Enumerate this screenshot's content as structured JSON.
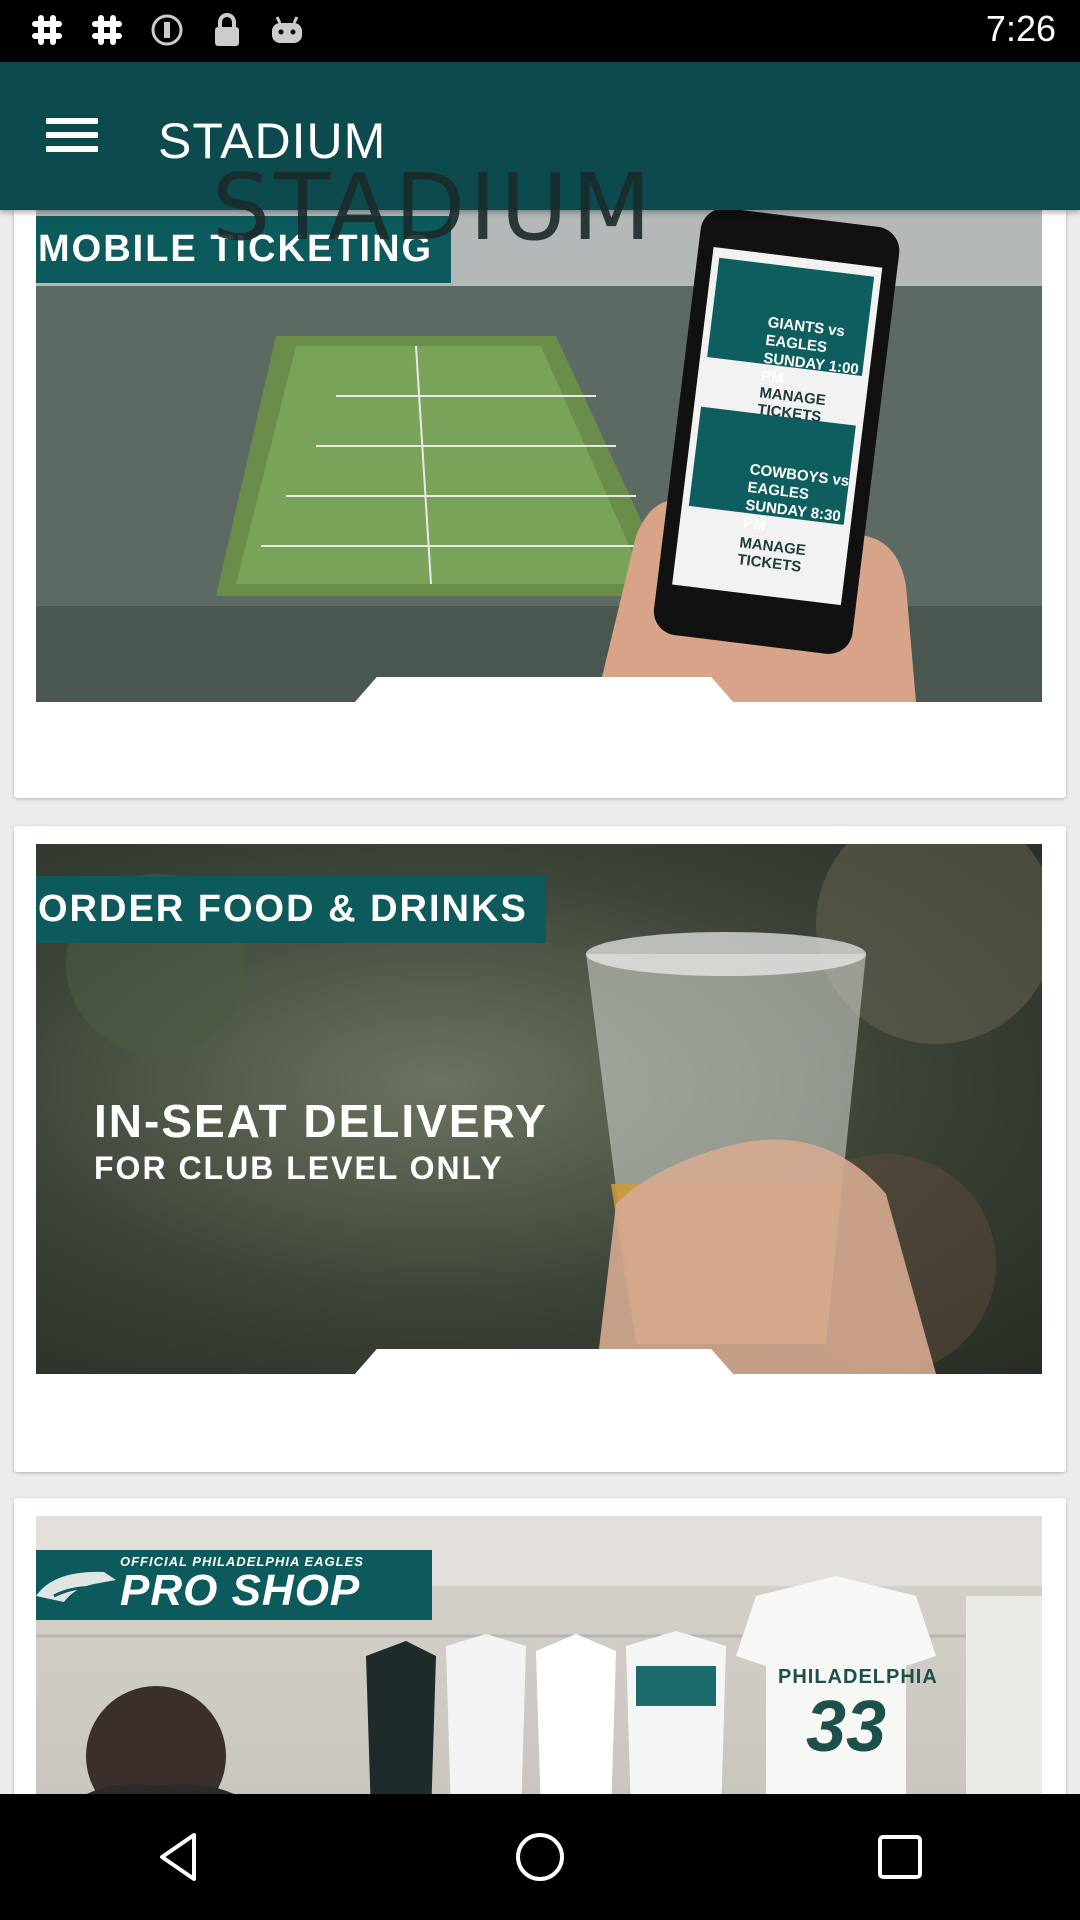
{
  "status_bar": {
    "time": "7:26",
    "icons": [
      "slack-icon",
      "slack-icon",
      "circle-info-icon",
      "lock-icon",
      "android-icon"
    ]
  },
  "app_bar": {
    "menu_icon": "hamburger-menu-icon",
    "title": "STADIUM",
    "logo_text": "STADIUM"
  },
  "cards": [
    {
      "badge": "MOBILE TICKETING",
      "phone_tickets": [
        {
          "match": "GIANTS vs EAGLES",
          "time": "SUNDAY 1:00 PM",
          "action": "MANAGE TICKETS"
        },
        {
          "match": "COWBOYS vs EAGLES",
          "time": "SUNDAY 8:30 PM",
          "action": "MANAGE TICKETS"
        }
      ]
    },
    {
      "badge": "ORDER FOOD & DRINKS",
      "headline": "IN-SEAT DELIVERY",
      "subline": "FOR CLUB LEVEL ONLY"
    },
    {
      "badge_small": "OFFICIAL PHILADELPHIA EAGLES",
      "badge": "PRO SHOP",
      "shirt_text": "PHILADELPHIA",
      "shirt_number": "33"
    }
  ],
  "nav_bar": {
    "icons": [
      "back-icon",
      "home-icon",
      "recents-icon"
    ]
  },
  "colors": {
    "app_bar": "#0c4a4d",
    "badge": "#0d5a5c"
  }
}
